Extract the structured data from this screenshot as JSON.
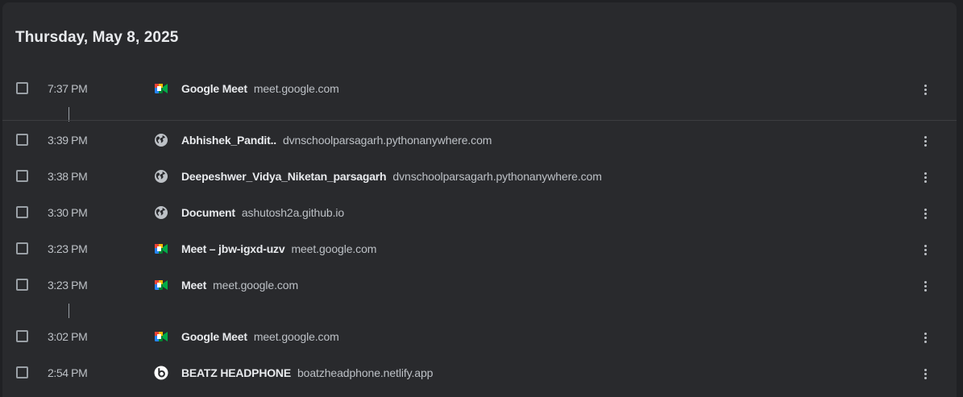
{
  "date_header": "Thursday, May 8, 2025",
  "entries": [
    {
      "time": "7:37 PM",
      "title": "Google Meet",
      "domain": "meet.google.com",
      "icon": "google-meet-icon"
    },
    {
      "time": "3:39 PM",
      "title": "Abhishek_Pandit..",
      "domain": "dvnschoolparsagarh.pythonanywhere.com",
      "icon": "globe-icon"
    },
    {
      "time": "3:38 PM",
      "title": "Deepeshwer_Vidya_Niketan_parsagarh",
      "domain": "dvnschoolparsagarh.pythonanywhere.com",
      "icon": "globe-icon"
    },
    {
      "time": "3:30 PM",
      "title": "Document",
      "domain": "ashutosh2a.github.io",
      "icon": "globe-icon"
    },
    {
      "time": "3:23 PM",
      "title": "Meet – jbw-igxd-uzv",
      "domain": "meet.google.com",
      "icon": "google-meet-icon"
    },
    {
      "time": "3:23 PM",
      "title": "Meet",
      "domain": "meet.google.com",
      "icon": "google-meet-icon"
    },
    {
      "time": "3:02 PM",
      "title": "Google Meet",
      "domain": "meet.google.com",
      "icon": "google-meet-icon"
    },
    {
      "time": "2:54 PM",
      "title": "BEATZ HEADPHONE",
      "domain": "boatzheadphone.netlify.app",
      "icon": "beats-icon"
    }
  ],
  "colors": {
    "background": "#202124",
    "card": "#292a2d",
    "title_text": "#e8eaed",
    "secondary_text": "#bdc1c6"
  }
}
